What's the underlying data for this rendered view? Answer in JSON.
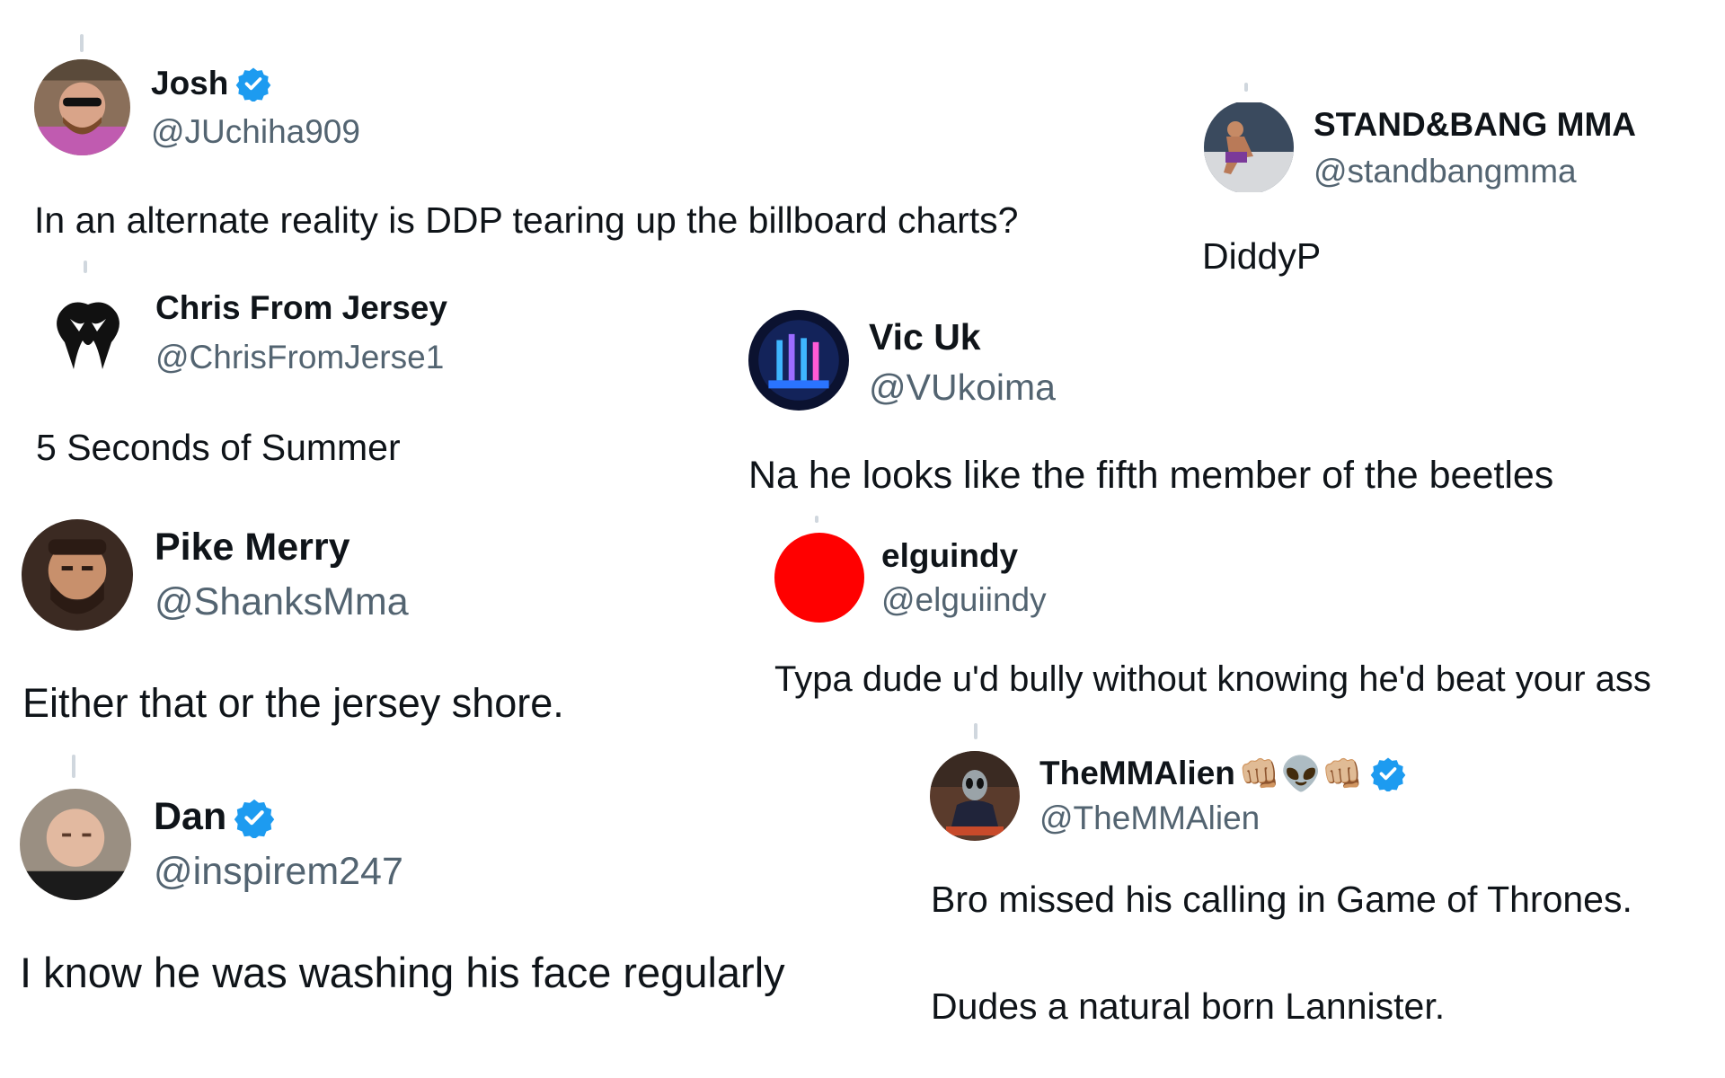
{
  "tweets": [
    {
      "name": "Josh",
      "handle": "@JUchiha909",
      "text": "In an alternate reality is DDP tearing up the billboard charts?"
    },
    {
      "name": "STAND&BANG MMA",
      "handle": "@standbangmma",
      "text": "DiddyP"
    },
    {
      "name": "Chris From Jersey",
      "handle": "@ChrisFromJerse1",
      "text": "5 Seconds of Summer"
    },
    {
      "name": "Vic Uk",
      "handle": "@VUkoima",
      "text": "Na he looks like the fifth member of the beetles"
    },
    {
      "name": "Pike Merry",
      "handle": "@ShanksMma",
      "text": "Either that or the jersey shore."
    },
    {
      "name": "elguindy",
      "handle": "@elguiindy",
      "text": "Typa dude u'd bully without knowing he'd beat your ass"
    },
    {
      "name": "Dan",
      "handle": "@inspirem247",
      "text": "I know he was washing his face regularly"
    },
    {
      "name": "TheMMAlien",
      "name_emoji": "👊🏼👽👊🏼",
      "handle": "@TheMMAlien",
      "text": "Bro missed his calling in Game of Thrones.",
      "text2": "Dudes a natural born Lannister."
    }
  ],
  "icons": {
    "verified": "verified-badge-icon",
    "verified_color": "#1d9bf0",
    "elguindy_avatar_color": "#ff0000"
  }
}
